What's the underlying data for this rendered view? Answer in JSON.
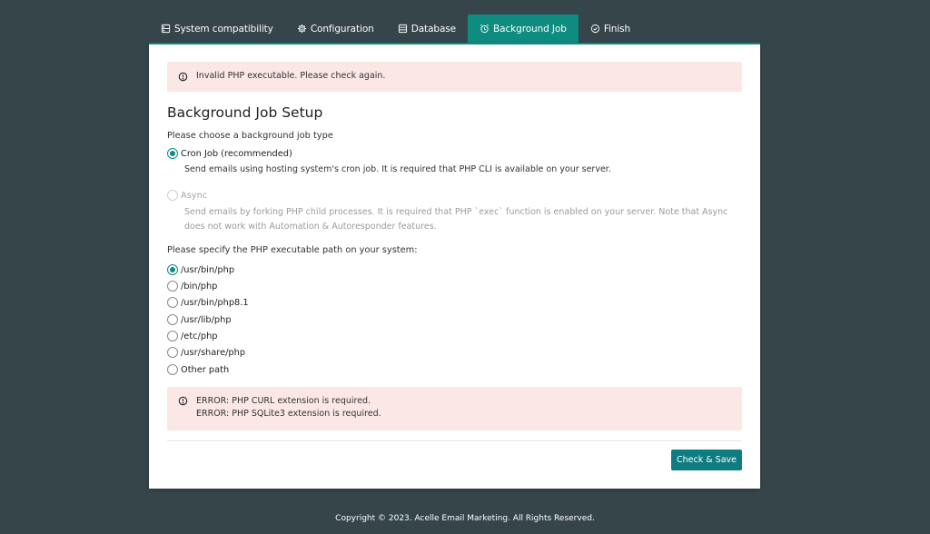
{
  "tabs": [
    {
      "label": "System compatibility",
      "icon": "server-icon",
      "active": false
    },
    {
      "label": "Configuration",
      "icon": "gear-icon",
      "active": false
    },
    {
      "label": "Database",
      "icon": "database-icon",
      "active": false
    },
    {
      "label": "Background Job",
      "icon": "alarm-clock-icon",
      "active": true
    },
    {
      "label": "Finish",
      "icon": "check-circle-icon",
      "active": false
    }
  ],
  "alert_top": {
    "text": "Invalid PHP executable. Please check again."
  },
  "setup": {
    "title": "Background Job Setup",
    "job_type_label": "Please choose a background job type",
    "options": [
      {
        "label": "Cron Job (recommended)",
        "checked": true,
        "disabled": false,
        "description": "Send emails using hosting system's cron job. It is required that PHP CLI is available on your server."
      },
      {
        "label": "Async",
        "checked": false,
        "disabled": true,
        "description": "Send emails by forking PHP child processes. It is required that PHP `exec` function is enabled on your server. Note that Async does not work with Automation & Autoresponder features."
      }
    ],
    "path_label": "Please specify the PHP executable path on your system:",
    "paths": [
      {
        "label": "/usr/bin/php",
        "checked": true
      },
      {
        "label": "/bin/php",
        "checked": false
      },
      {
        "label": "/usr/bin/php8.1",
        "checked": false
      },
      {
        "label": "/usr/lib/php",
        "checked": false
      },
      {
        "label": "/etc/php",
        "checked": false
      },
      {
        "label": "/usr/share/php",
        "checked": false
      },
      {
        "label": "Other path",
        "checked": false
      }
    ]
  },
  "alert_bottom": {
    "lines": [
      "ERROR: PHP CURL extension is required.",
      "ERROR: PHP SQLite3 extension is required."
    ]
  },
  "actions": {
    "check_save": "Check & Save"
  },
  "footer": {
    "text": "Copyright © 2023. Acelle Email Marketing. All Rights Reserved."
  },
  "colors": {
    "accent": "#0f8c80",
    "button": "#0d7d82",
    "background": "#35454a",
    "alert_bg": "#fbe7e4"
  }
}
